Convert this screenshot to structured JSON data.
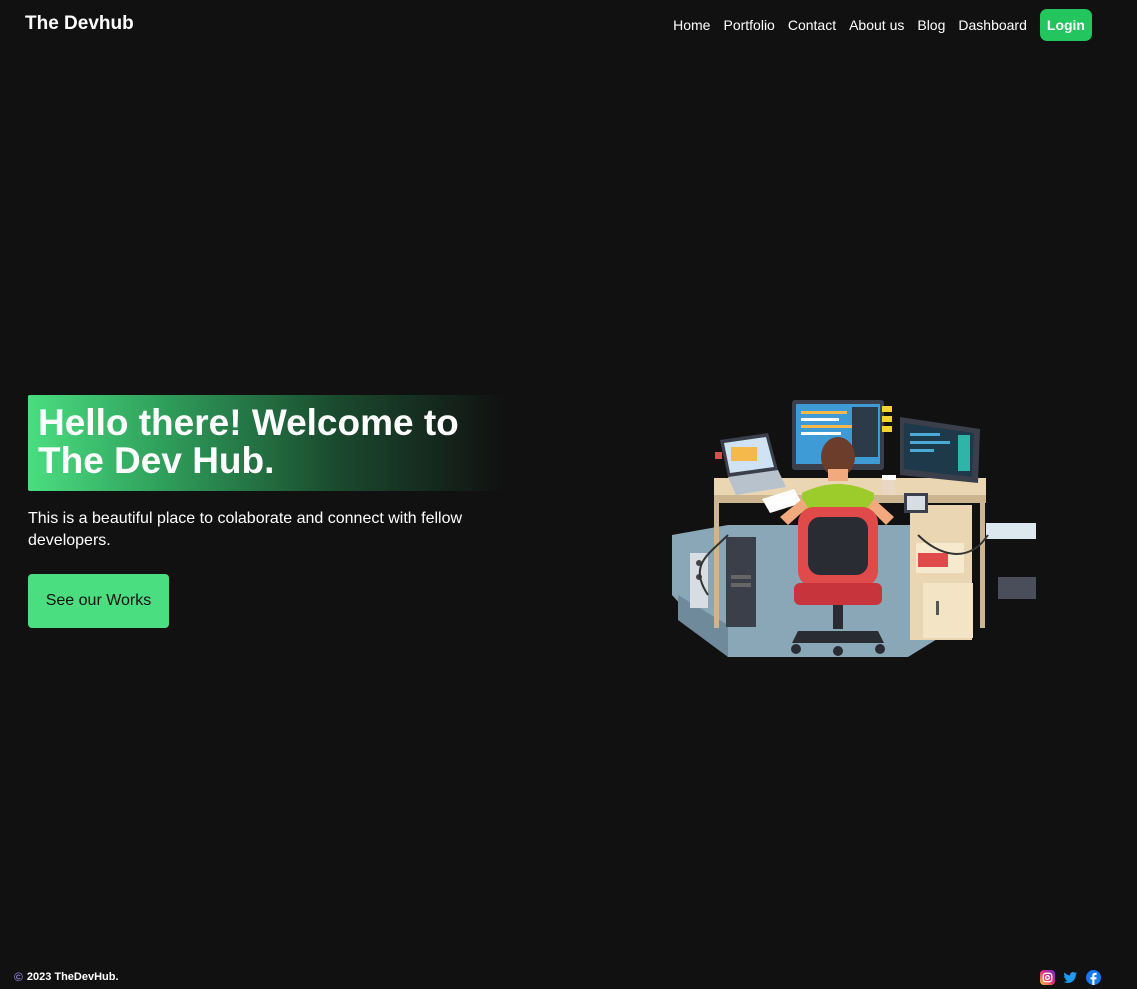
{
  "header": {
    "logo": "The Devhub",
    "nav": [
      "Home",
      "Portfolio",
      "Contact",
      "About us",
      "Blog",
      "Dashboard"
    ],
    "login_label": "Login"
  },
  "hero": {
    "title": "Hello there! Welcome to The Dev Hub.",
    "subtitle": "This is a beautiful place to colaborate and connect with fellow developers.",
    "cta_label": "See our Works",
    "illustration_icon": "developer-at-desk-illustration"
  },
  "footer": {
    "copyright_symbol": "©",
    "copyright_text": "2023 TheDevHub.",
    "social_icons": [
      "instagram-icon",
      "twitter-icon",
      "facebook-icon"
    ]
  },
  "colors": {
    "background": "#111111",
    "accent": "#22c55e",
    "accent_light": "#4ade80"
  }
}
